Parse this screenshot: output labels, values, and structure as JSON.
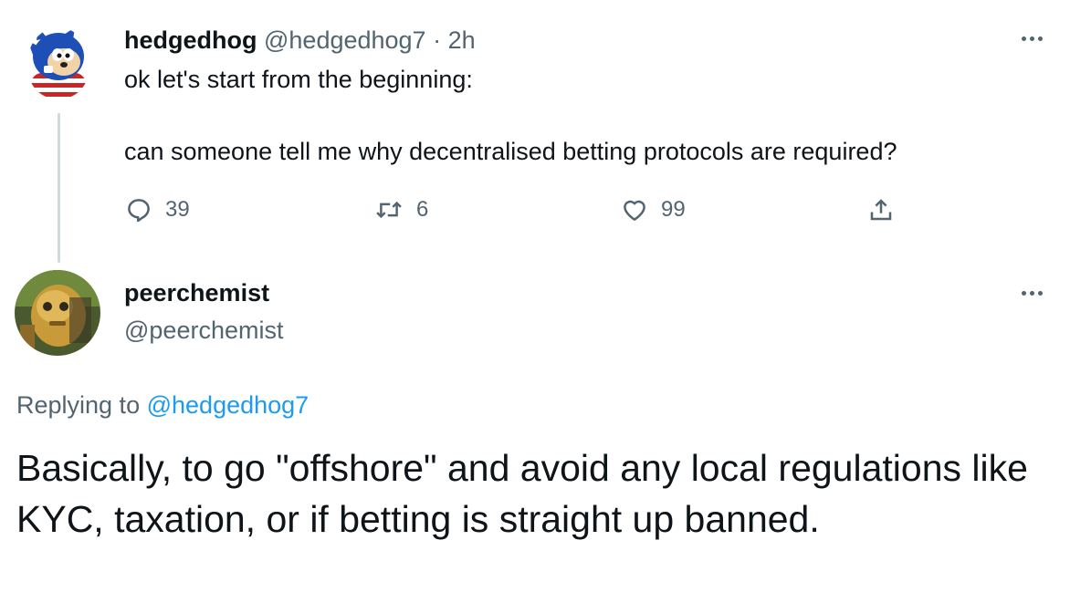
{
  "tweet1": {
    "display_name": "hedgedhog",
    "handle": "@hedgedhog7",
    "separator": "·",
    "time": "2h",
    "line1": "ok let's start from the beginning:",
    "line2": "can someone tell me why decentralised betting protocols are required?",
    "reply_count": "39",
    "retweet_count": "6",
    "like_count": "99",
    "avatar_icon": "hedgehog-avatar-icon"
  },
  "tweet2": {
    "display_name": "peerchemist",
    "handle": "@peerchemist",
    "replying_prefix": "Replying to",
    "replying_to": "@hedgedhog7",
    "body": "Basically, to go \"offshore\" and avoid any local regulations like KYC, taxation, or if betting is straight up banned.",
    "avatar_icon": "robot-avatar-icon"
  },
  "colors": {
    "text": "#0f1419",
    "muted": "#536471",
    "link": "#1d9bf0",
    "thread_line": "#cfd9de"
  }
}
